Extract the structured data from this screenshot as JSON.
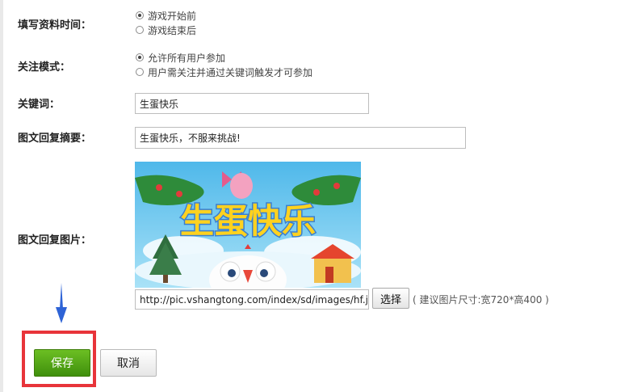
{
  "form": {
    "fill_time": {
      "label": "填写资料时间：",
      "options": [
        {
          "label": "游戏开始前",
          "checked": true
        },
        {
          "label": "游戏结束后",
          "checked": false
        }
      ]
    },
    "follow_mode": {
      "label": "关注模式：",
      "options": [
        {
          "label": "允许所有用户参加",
          "checked": true
        },
        {
          "label": "用户需关注并通过关键词触发才可参加",
          "checked": false
        }
      ]
    },
    "keyword": {
      "label": "关键词：",
      "value": "生蛋快乐"
    },
    "summary": {
      "label": "图文回复摘要：",
      "value": "生蛋快乐，不服来挑战!"
    },
    "image": {
      "label": "图文回复图片：",
      "banner_text": "生蛋快乐",
      "url_value": "http://pic.vshangtong.com/index/sd/images/hf.jpg",
      "choose_label": "选择",
      "size_hint": "( 建议图片尺寸:宽720*高400 )"
    }
  },
  "actions": {
    "save_label": "保存",
    "cancel_label": "取消"
  },
  "colors": {
    "save": "#4f9e15",
    "highlight": "#e8343a",
    "arrow": "#2e63d6"
  }
}
